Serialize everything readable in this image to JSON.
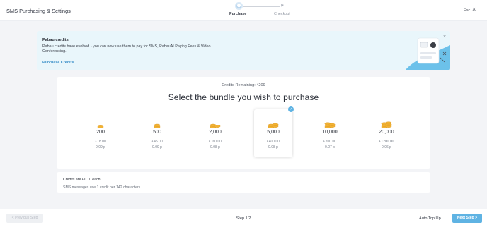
{
  "header": {
    "title": "SMS Purchasing & Settings",
    "esc_label": "Esc",
    "close_glyph": "×",
    "steps": [
      {
        "label": "Purchase",
        "active": true
      },
      {
        "label": "Checkout",
        "active": false
      }
    ]
  },
  "banner": {
    "title": "Pabau credits",
    "body": "Pabau credits have evolved - you can now use them to pay for SMS, PabauAI Paying Fees & Video Conferencing.",
    "link": "Purchase Credits",
    "close_glyph": "×"
  },
  "bundles_section": {
    "credits_remaining": "Credits Remaining: 4209",
    "title": "Select the bundle you wish to purchase",
    "selected_index": 3,
    "bundles": [
      {
        "qty": "200",
        "price": "£18.00",
        "per_unit": "0.09 p",
        "coins": 1
      },
      {
        "qty": "500",
        "price": "£45.00",
        "per_unit": "0.09 p",
        "coins": 2
      },
      {
        "qty": "2,000",
        "price": "£160.00",
        "per_unit": "0.08 p",
        "coins": 3
      },
      {
        "qty": "5,000",
        "price": "£400.00",
        "per_unit": "0.08 p",
        "coins": 4
      },
      {
        "qty": "10,000",
        "price": "£700.00",
        "per_unit": "0.07 p",
        "coins": 5
      },
      {
        "qty": "20,000",
        "price": "£1200.00",
        "per_unit": "0.06 p",
        "coins": 6
      }
    ]
  },
  "info": {
    "line1": "Credits are £0.10 each.",
    "line2": "SMS messages use 1 credit per 142 characters."
  },
  "footer": {
    "prev_label": "< Previous Step",
    "step_count": "Step 1/2",
    "auto_topup": "Auto Top Up",
    "next_label": "Next Step >"
  },
  "colors": {
    "accent": "#5fb3e3",
    "banner_bg": "#e9f6fb",
    "coin": "#f2b233",
    "link": "#3a8fc8"
  }
}
